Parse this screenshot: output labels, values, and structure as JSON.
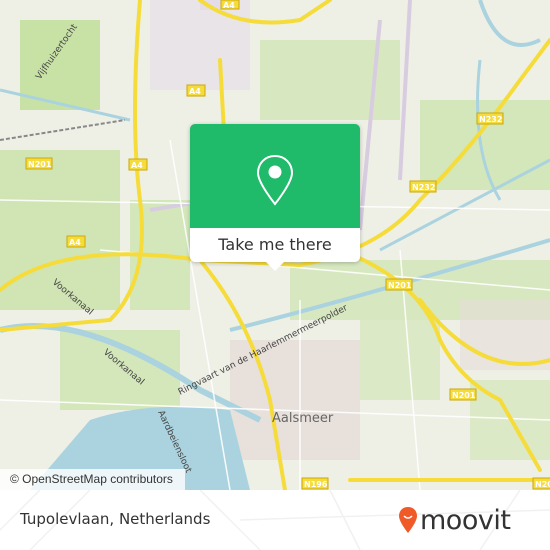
{
  "map": {
    "attribution": "© OpenStreetMap contributors",
    "place_labels": {
      "town": "Aalsmeer",
      "ringvaart": "Ringvaart van de Haarlemmermeerpolder",
      "voorkanaal1": "Voorkanaal",
      "voorkanaal2": "Voorkanaal",
      "aardbeiensloot": "Aardbeiensloot",
      "vijfhuizertocht": "Vijfhuizertocht"
    },
    "road_shields": {
      "a4_top": "A4",
      "a4_1": "A4",
      "a4_2": "A4",
      "a4_3": "A4",
      "n201_left": "N201",
      "n201_mid": "N201",
      "n201_right": "N201",
      "n232_top": "N232",
      "n232_mid": "N232",
      "n196": "N196",
      "n20x": "N20"
    },
    "colors": {
      "land": "#eef0e6",
      "green": "#c8e2a6",
      "water": "#aad3df",
      "road": "#f6dc3a",
      "accent": "#1fba6a"
    }
  },
  "popup": {
    "icon": "map-pin-icon",
    "button_label": "Take me there"
  },
  "footer": {
    "place": "Tupolevlaan, Netherlands",
    "brand": "moovit",
    "brand_color": "#f05a28"
  }
}
